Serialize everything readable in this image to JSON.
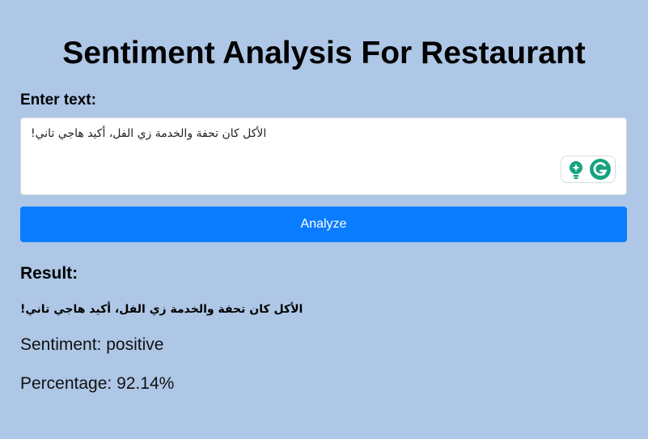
{
  "page": {
    "title": "Sentiment Analysis For Restaurant"
  },
  "form": {
    "label": "Enter text:",
    "input_value": "الأكل كان تحفة والخدمة زي الفل، أكيد هاجي تاني!",
    "analyze_label": "Analyze"
  },
  "extension": {
    "icons": [
      "bulb-icon",
      "grammarly-icon"
    ],
    "colors": {
      "bulb": "#15a37f",
      "grammarly": "#15a37f"
    }
  },
  "result": {
    "heading": "Result:",
    "text": "الأكل كان تحفة والخدمة زي الفل، أكيد هاجي تاني!",
    "sentiment_line": "Sentiment: positive",
    "percentage_line": "Percentage: 92.14%"
  },
  "colors": {
    "background": "#aec7e6",
    "button": "#0a7cff",
    "input_bg": "#ffffff"
  }
}
